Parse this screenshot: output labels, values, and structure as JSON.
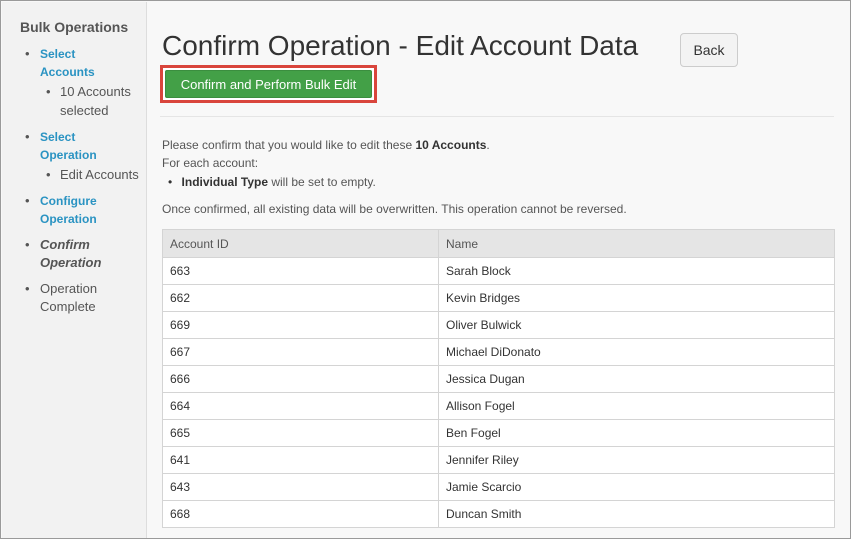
{
  "sidebar": {
    "title": "Bulk Operations",
    "steps": [
      {
        "label": "Select Accounts",
        "sub": "10 Accounts selected"
      },
      {
        "label": "Select Operation",
        "sub": "Edit Accounts"
      },
      {
        "label": "Configure Operation"
      },
      {
        "label": "Confirm Operation"
      },
      {
        "label": "Operation Complete"
      }
    ]
  },
  "header": {
    "title": "Confirm Operation - Edit Account Data",
    "back_label": "Back",
    "confirm_label": "Confirm and Perform Bulk Edit"
  },
  "message": {
    "intro_prefix": "Please confirm that you would like to edit these ",
    "intro_count": "10 Accounts",
    "intro_suffix": ".",
    "for_each": "For each account:",
    "field_name": "Individual Type",
    "field_action": " will be set to empty.",
    "warning": "Once confirmed, all existing data will be overwritten. This operation cannot be reversed."
  },
  "table": {
    "columns": [
      "Account ID",
      "Name"
    ],
    "rows": [
      {
        "id": "663",
        "name": "Sarah Block"
      },
      {
        "id": "662",
        "name": "Kevin Bridges"
      },
      {
        "id": "669",
        "name": "Oliver Bulwick"
      },
      {
        "id": "667",
        "name": "Michael DiDonato"
      },
      {
        "id": "666",
        "name": "Jessica Dugan"
      },
      {
        "id": "664",
        "name": "Allison Fogel"
      },
      {
        "id": "665",
        "name": "Ben Fogel"
      },
      {
        "id": "641",
        "name": "Jennifer Riley"
      },
      {
        "id": "643",
        "name": "Jamie Scarcio"
      },
      {
        "id": "668",
        "name": "Duncan Smith"
      }
    ]
  },
  "colors": {
    "link": "#2a93c2",
    "confirm_button": "#43a047",
    "highlight_border": "#d9453c"
  }
}
